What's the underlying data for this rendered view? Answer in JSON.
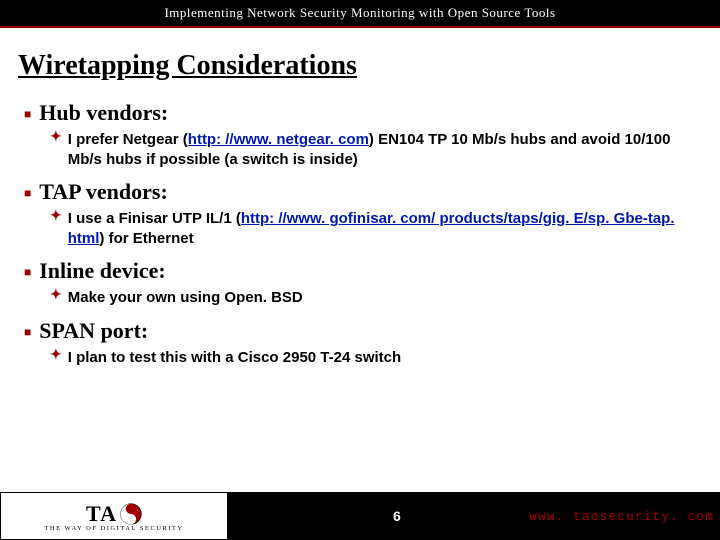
{
  "header": {
    "title": "Implementing Network Security Monitoring with Open Source Tools"
  },
  "slide": {
    "title": "Wiretapping Considerations",
    "topics": [
      {
        "heading": "Hub vendors:",
        "detail_pre": "I prefer Netgear (",
        "detail_link": "http: //www. netgear. com",
        "detail_post": ") EN104 TP 10 Mb/s hubs and avoid 10/100 Mb/s hubs if possible (a switch is inside)"
      },
      {
        "heading": "TAP vendors:",
        "detail_pre": "I use a Finisar UTP IL/1 (",
        "detail_link": "http: //www. gofinisar. com/ products/taps/gig. E/sp. Gbe-tap. html",
        "detail_post": ") for Ethernet"
      },
      {
        "heading": "Inline device:",
        "detail_pre": "Make your own using Open. BSD",
        "detail_link": "",
        "detail_post": ""
      },
      {
        "heading": "SPAN port:",
        "detail_pre": "I plan to test this with a Cisco 2950 T-24 switch",
        "detail_link": "",
        "detail_post": ""
      }
    ]
  },
  "footer": {
    "logo_text": "TA",
    "logo_tag": "THE WAY OF DIGITAL SECURITY",
    "page": "6",
    "url": "www. taosecurity. com"
  }
}
